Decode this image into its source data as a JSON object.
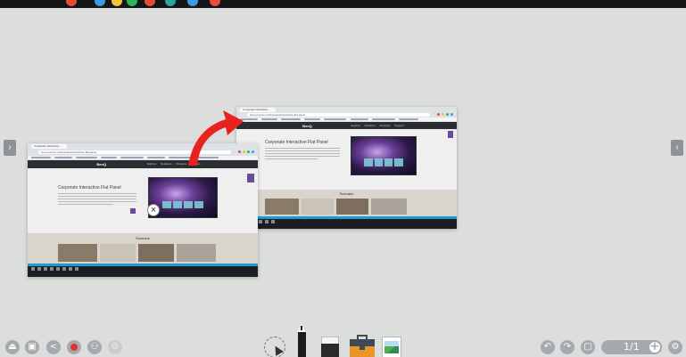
{
  "topbar": {
    "tray_text": ""
  },
  "toolbar": {
    "left_buttons": [
      {
        "name": "exit-icon",
        "glyph": "⏏"
      },
      {
        "name": "save-icon",
        "glyph": "▣"
      },
      {
        "name": "share-icon",
        "glyph": "<"
      },
      {
        "name": "record-icon",
        "glyph": ""
      },
      {
        "name": "users-icon",
        "glyph": "⚇"
      },
      {
        "name": "settings-gear-icon",
        "glyph": "⚙"
      }
    ],
    "right_buttons": [
      {
        "name": "undo-icon",
        "glyph": "↶"
      },
      {
        "name": "redo-icon",
        "glyph": "↷"
      },
      {
        "name": "page-overview-icon",
        "glyph": "▢"
      }
    ],
    "page_indicator": "1/1",
    "add_page_glyph": "+",
    "settings_glyph": "⚙"
  },
  "side_tabs": {
    "left": "›",
    "right": "‹"
  },
  "screenshots": {
    "small": {
      "tab": "Corporate Interactive...",
      "address": "benq.com/en-us/business/interactive-flat-panel",
      "nav_logo": "BenQ",
      "nav_menu": "Explore Solutions Products Support",
      "page_title": "Corporate Interactive Flat Panel",
      "scenario_label": "Scenario"
    },
    "large": {
      "tab": "Corporate Interactive...",
      "address": "benq.com/en-us/business/interactive-flat-panel",
      "nav_logo": "BenQ",
      "nav_menu": "Explore Solutions Products Support",
      "page_title": "Corporate Interactive Flat Panel",
      "scenario_label": "Scenario"
    }
  },
  "close_glyph": "×",
  "colors": {
    "accent_red": "#e8231f",
    "panel_purple": "#6b4c98",
    "toolbar_gray": "#a6a9ad",
    "record_red": "#e0312f"
  }
}
